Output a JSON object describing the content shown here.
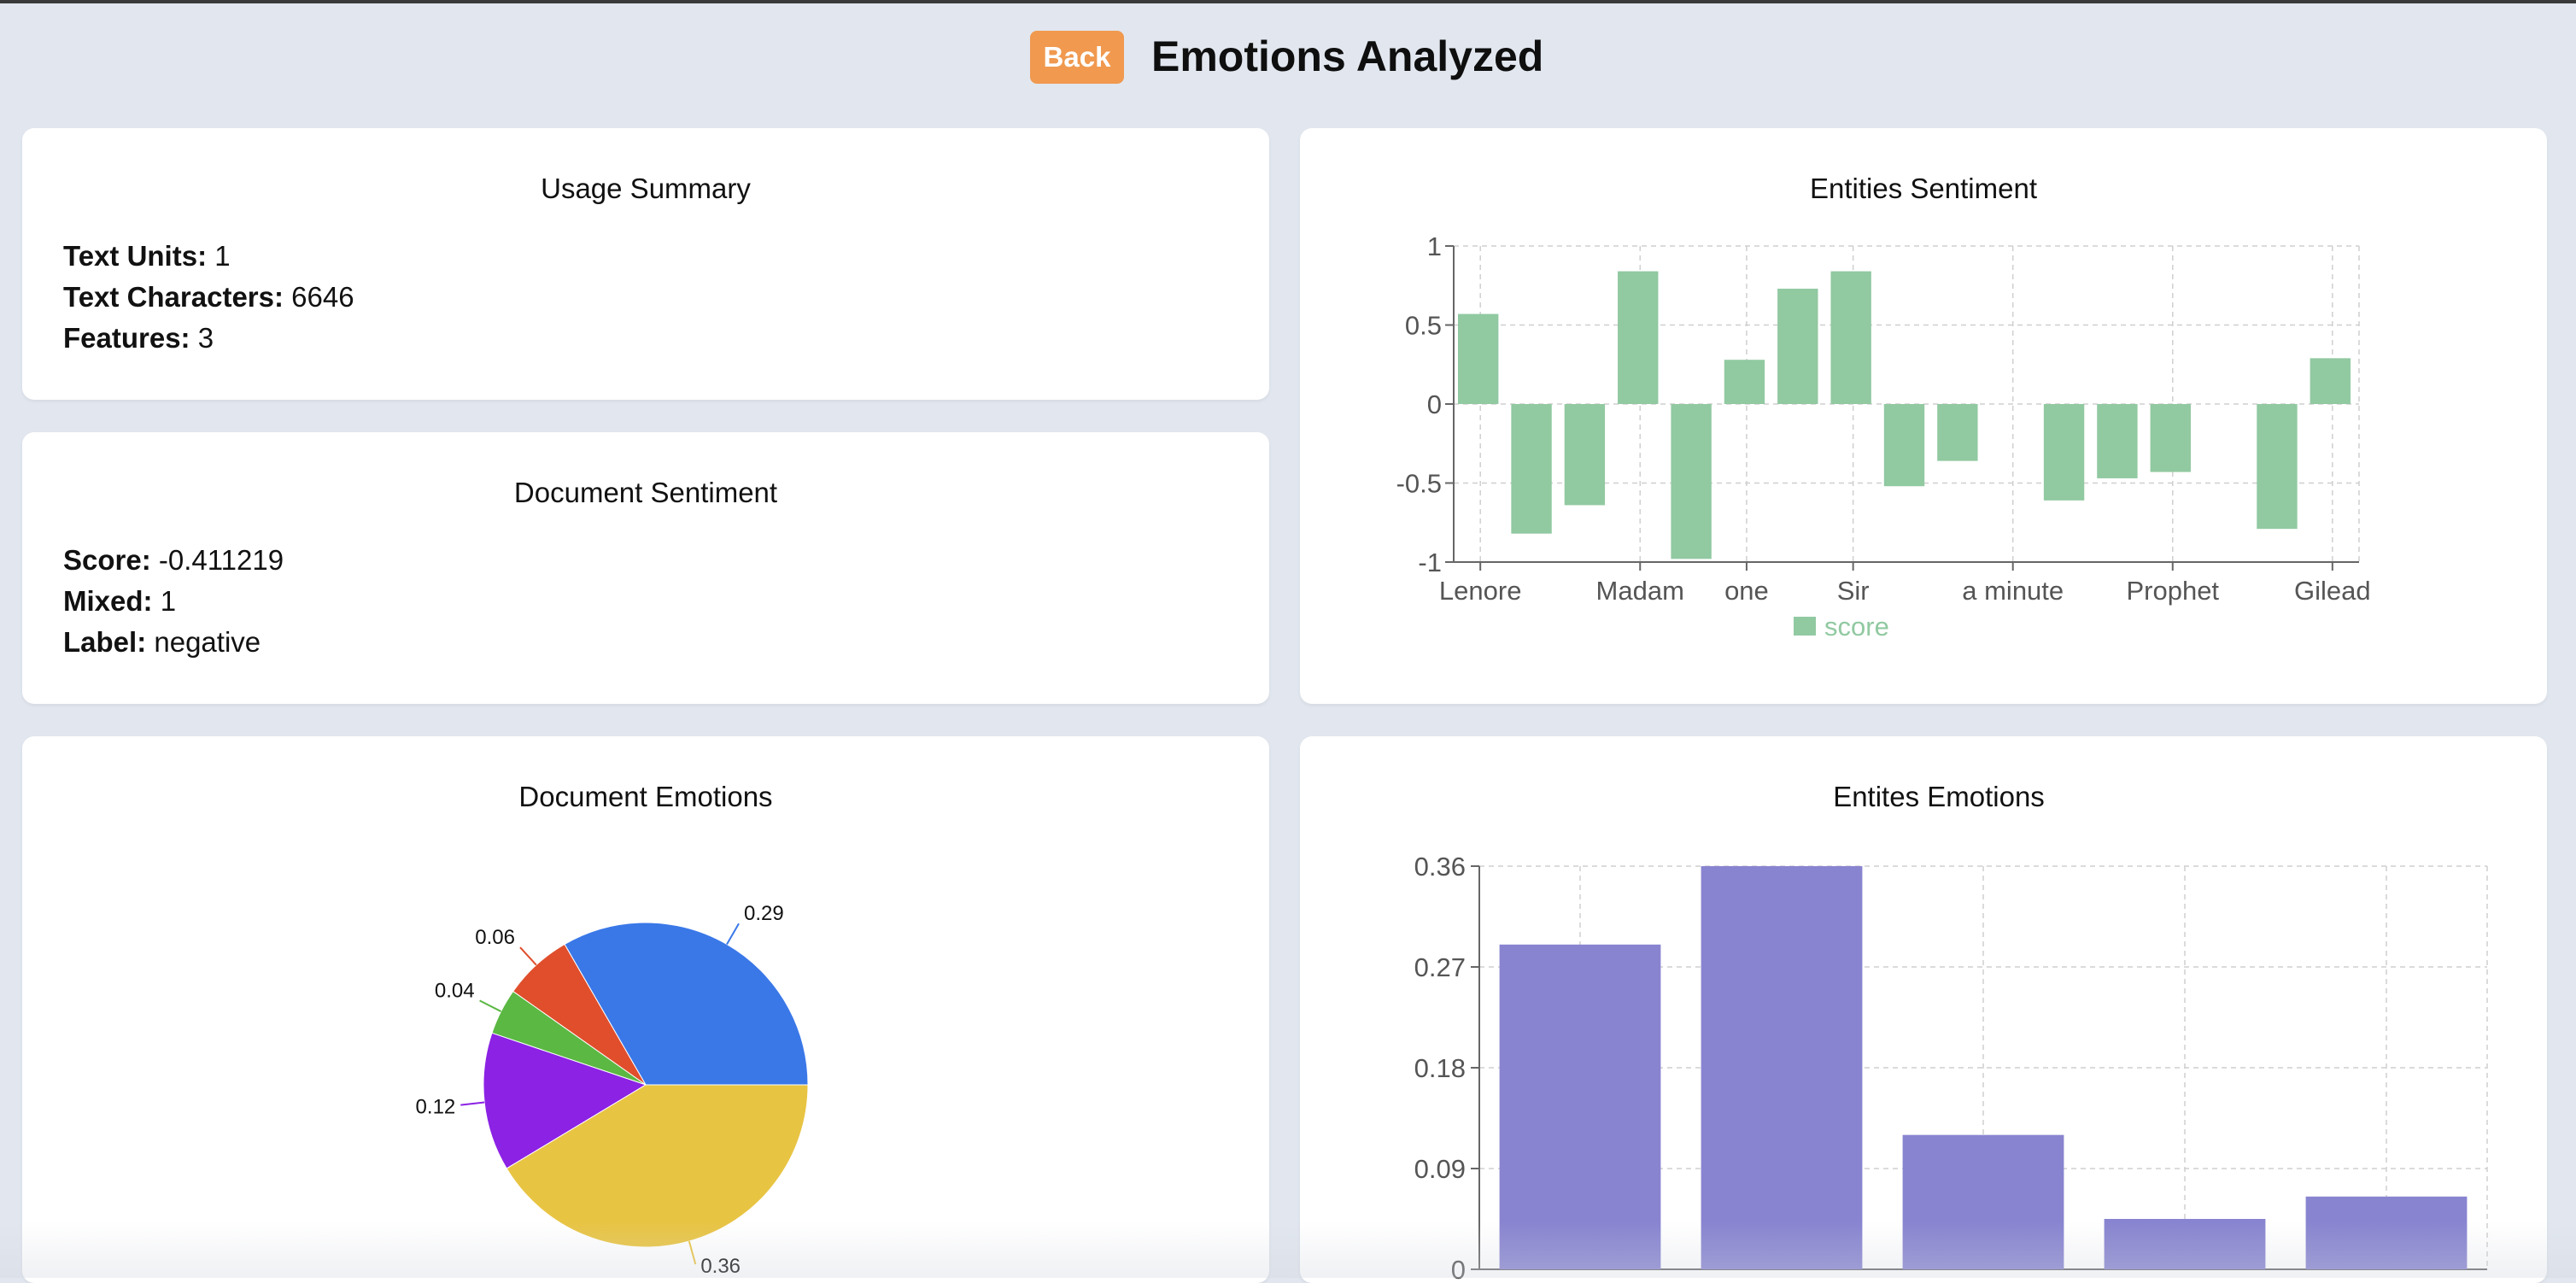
{
  "header": {
    "back_label": "Back",
    "title": "Emotions Analyzed"
  },
  "usage_summary": {
    "title": "Usage Summary",
    "items": [
      {
        "label": "Text Units:",
        "value": "1"
      },
      {
        "label": "Text Characters:",
        "value": "6646"
      },
      {
        "label": "Features:",
        "value": "3"
      }
    ]
  },
  "document_sentiment": {
    "title": "Document Sentiment",
    "items": [
      {
        "label": "Score:",
        "value": "-0.411219"
      },
      {
        "label": "Mixed:",
        "value": "1"
      },
      {
        "label": "Label:",
        "value": "negative"
      }
    ]
  },
  "colors": {
    "background": "#e2e7ef",
    "back_button": "#f0994f",
    "sentiment_bar": "#91c9a1",
    "emotion_bar": "#8884d0",
    "pie": [
      "#3a78e8",
      "#e04e2c",
      "#5bb843",
      "#8c22e4",
      "#e8c443"
    ]
  },
  "chart_data": [
    {
      "title": "Entities Sentiment",
      "type": "bar",
      "categories": [
        "Lenore",
        "",
        "",
        "Madam",
        "",
        "one",
        "",
        "Sir",
        "",
        "",
        "a minute",
        "",
        "",
        "Prophet",
        "",
        "",
        "Gilead"
      ],
      "series": [
        {
          "name": "score",
          "values": [
            0.57,
            -0.82,
            -0.64,
            0.84,
            -0.98,
            0.28,
            0.73,
            0.84,
            -0.52,
            -0.36,
            0,
            -0.61,
            -0.47,
            -0.43,
            0,
            -0.79,
            0.29
          ]
        }
      ],
      "yticks": [
        "1",
        "0.5",
        "0",
        "-0.5",
        "-1"
      ],
      "ylim": [
        -1,
        1
      ],
      "grid": true,
      "legend": "bottom"
    },
    {
      "title": "Document Emotions",
      "type": "pie",
      "slices": [
        {
          "value": 0.29,
          "color": "#3a78e8"
        },
        {
          "value": 0.06,
          "color": "#e04e2c"
        },
        {
          "value": 0.04,
          "color": "#5bb843"
        },
        {
          "value": 0.12,
          "color": "#8c22e4"
        },
        {
          "value": 0.36,
          "color": "#e8c443"
        }
      ],
      "labels": [
        "0.29",
        "0.06",
        "0.04",
        "0.12",
        "0.36"
      ]
    },
    {
      "title": "Entites Emotions",
      "type": "bar",
      "values": [
        0.29,
        0.36,
        0.12,
        0.045,
        0.065
      ],
      "yticks": [
        "0.36",
        "0.27",
        "0.18",
        "0.09",
        "0"
      ],
      "ylim": [
        0,
        0.36
      ],
      "grid": true
    }
  ]
}
